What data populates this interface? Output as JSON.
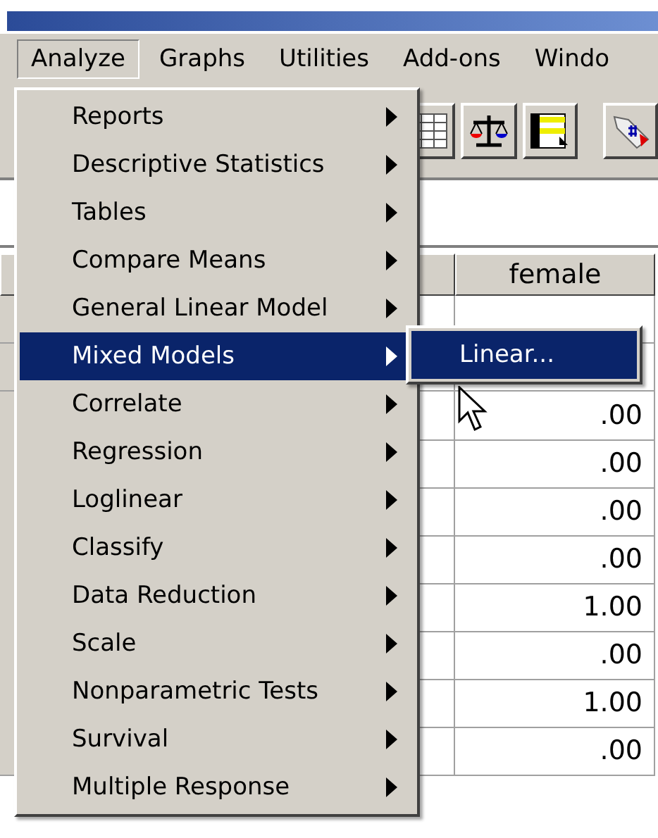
{
  "menubar": [
    {
      "label": "Analyze",
      "selected": true
    },
    {
      "label": "Graphs",
      "selected": false
    },
    {
      "label": "Utilities",
      "selected": false
    },
    {
      "label": "Add-ons",
      "selected": false
    },
    {
      "label": "Windo",
      "selected": false
    }
  ],
  "grid": {
    "columns": [
      {
        "label": "female"
      }
    ],
    "rows": [
      {
        "female": ".00"
      },
      {
        "female": ".00"
      },
      {
        "female": ".00"
      },
      {
        "female": ".00"
      },
      {
        "female": "1.00"
      },
      {
        "female": ".00"
      },
      {
        "female": "1.00"
      },
      {
        "female": ".00"
      }
    ]
  },
  "menu": {
    "items": [
      {
        "label": "Reports",
        "selected": false,
        "submenu": true
      },
      {
        "label": "Descriptive Statistics",
        "selected": false,
        "submenu": true
      },
      {
        "label": "Tables",
        "selected": false,
        "submenu": true
      },
      {
        "label": "Compare Means",
        "selected": false,
        "submenu": true
      },
      {
        "label": "General Linear Model",
        "selected": false,
        "submenu": true
      },
      {
        "label": "Mixed Models",
        "selected": true,
        "submenu": true
      },
      {
        "label": "Correlate",
        "selected": false,
        "submenu": true
      },
      {
        "label": "Regression",
        "selected": false,
        "submenu": true
      },
      {
        "label": "Loglinear",
        "selected": false,
        "submenu": true
      },
      {
        "label": "Classify",
        "selected": false,
        "submenu": true
      },
      {
        "label": "Data Reduction",
        "selected": false,
        "submenu": true
      },
      {
        "label": "Scale",
        "selected": false,
        "submenu": true
      },
      {
        "label": "Nonparametric Tests",
        "selected": false,
        "submenu": true
      },
      {
        "label": "Survival",
        "selected": false,
        "submenu": true
      },
      {
        "label": "Multiple Response",
        "selected": false,
        "submenu": true
      }
    ]
  },
  "submenu": {
    "items": [
      {
        "label": "Linear...",
        "selected": true
      }
    ]
  }
}
